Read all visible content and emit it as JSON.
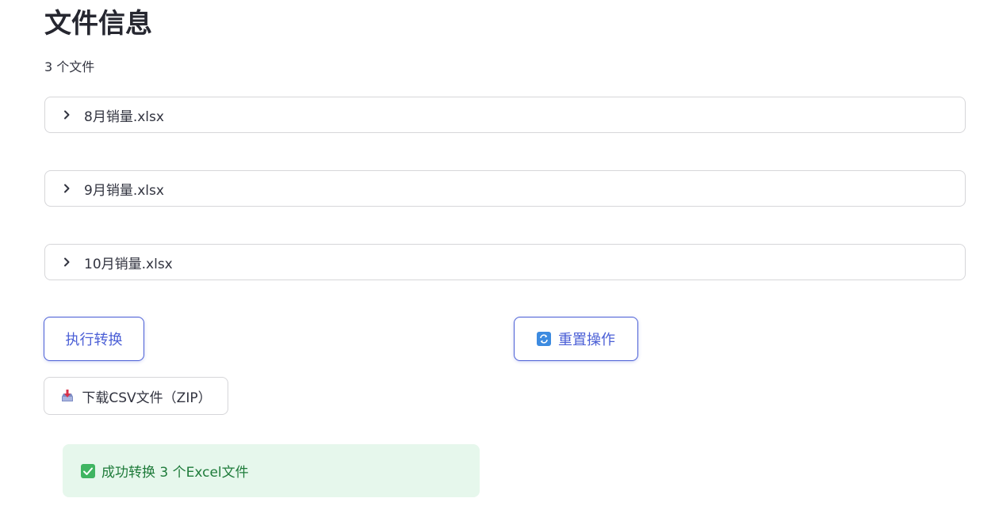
{
  "header": {
    "title": "文件信息",
    "file_count_text": "3 个文件"
  },
  "files": [
    {
      "label": "8月销量.xlsx"
    },
    {
      "label": "9月销量.xlsx"
    },
    {
      "label": "10月销量.xlsx"
    }
  ],
  "actions": {
    "convert_label": "执行转换",
    "reset_label": "重置操作",
    "reset_icon": "refresh-icon",
    "download_label": "下载CSV文件（ZIP）",
    "download_icon": "download-inbox-icon"
  },
  "alert": {
    "icon": "check-box-icon",
    "text": "成功转换 3 个Excel文件",
    "color": "#1e7b3a",
    "background": "#e6f7ec"
  },
  "colors": {
    "accent": "#4b5fd6",
    "border": "#d6d6d9",
    "text": "#31333f"
  }
}
